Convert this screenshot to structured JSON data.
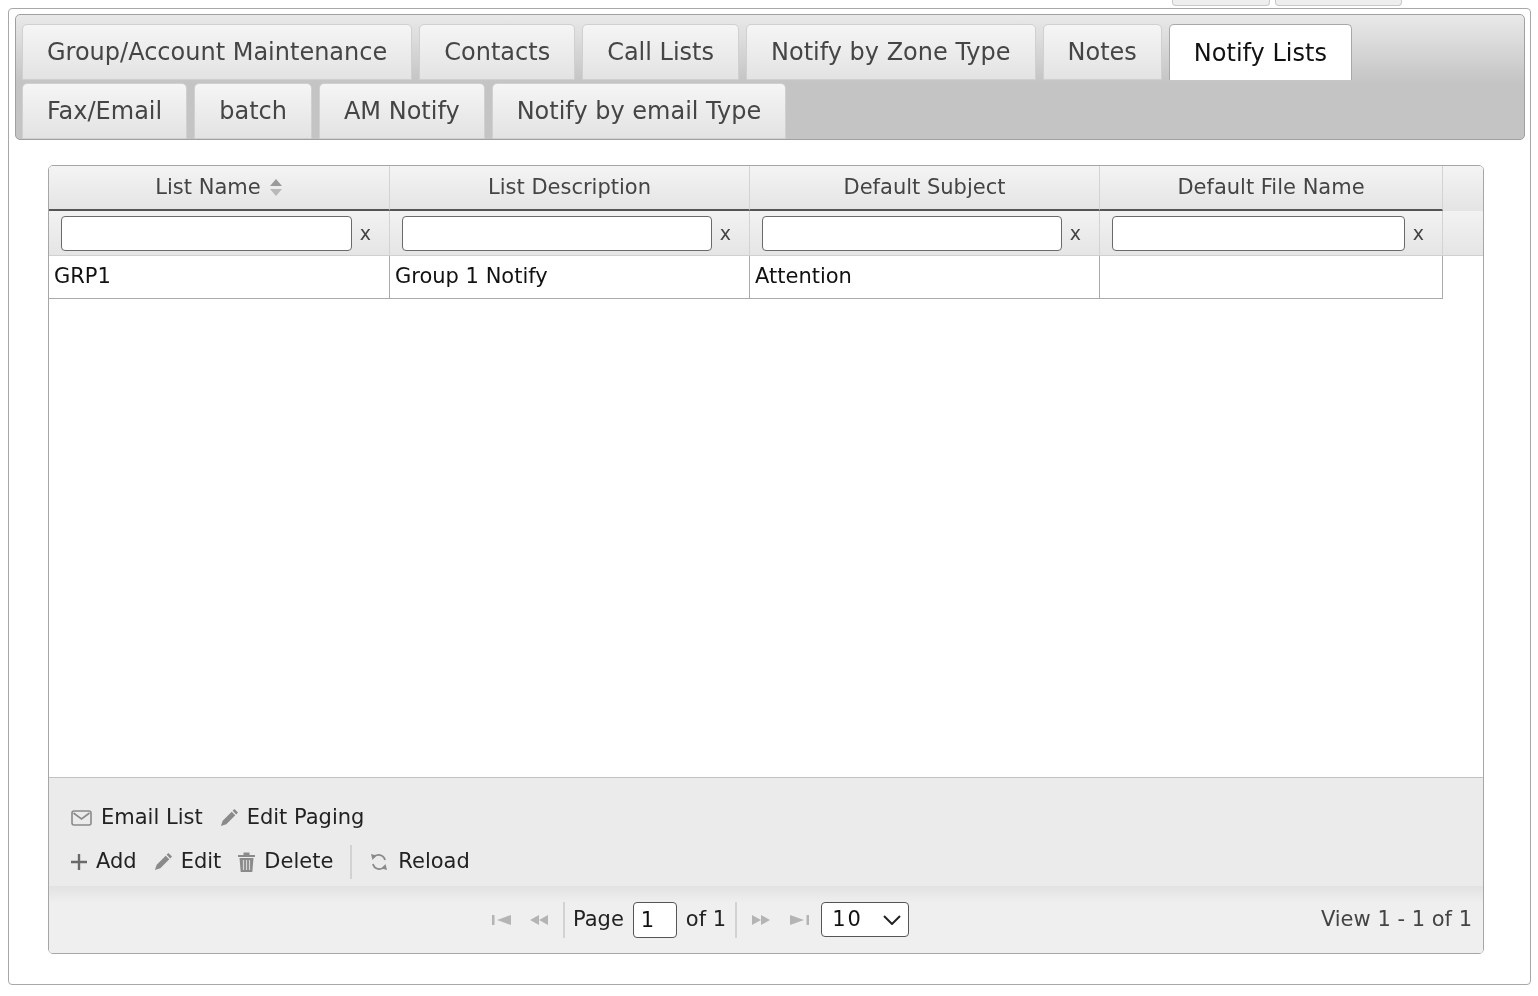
{
  "tab_rows": [
    {
      "tabs": [
        {
          "label": "Group/Account Maintenance",
          "selected": false
        },
        {
          "label": "Contacts",
          "selected": false
        },
        {
          "label": "Call Lists",
          "selected": false
        },
        {
          "label": "Notify by Zone Type",
          "selected": false
        },
        {
          "label": "Notes",
          "selected": false
        },
        {
          "label": "Notify Lists",
          "selected": true
        }
      ]
    },
    {
      "tabs": [
        {
          "label": "Fax/Email",
          "selected": false
        },
        {
          "label": "batch",
          "selected": false
        },
        {
          "label": "AM Notify",
          "selected": false
        },
        {
          "label": "Notify by email Type",
          "selected": false
        }
      ]
    }
  ],
  "grid": {
    "columns": [
      {
        "label": "List Name",
        "sorted": true
      },
      {
        "label": "List Description",
        "sorted": false
      },
      {
        "label": "Default Subject",
        "sorted": false
      },
      {
        "label": "Default File Name",
        "sorted": false
      }
    ],
    "filters": [
      {
        "clear": "x"
      },
      {
        "clear": "x"
      },
      {
        "clear": "x"
      },
      {
        "clear": "x"
      }
    ],
    "rows": [
      {
        "cells": [
          "GRP1",
          "Group 1 Notify",
          "Attention"
        ]
      }
    ],
    "toolbar": [
      {
        "items": [
          {
            "kind": "email",
            "label": "Email List"
          },
          {
            "kind": "edit",
            "label": "Edit Paging"
          }
        ]
      },
      {
        "items": [
          {
            "kind": "add",
            "label": "Add"
          },
          {
            "kind": "edit",
            "label": "Edit"
          },
          {
            "kind": "delete",
            "label": "Delete"
          },
          {
            "kind": "separator"
          },
          {
            "kind": "reload",
            "label": "Reload"
          }
        ]
      }
    ],
    "pager": {
      "nav_back": [
        {
          "kind": "first",
          "disabled": true
        },
        {
          "kind": "prev",
          "disabled": true
        }
      ],
      "page_label": "Page",
      "page": "1",
      "of_label": "of 1",
      "nav_forward": [
        {
          "kind": "next",
          "disabled": true
        },
        {
          "kind": "last",
          "disabled": true
        }
      ],
      "page_size": "10",
      "summary": "View 1 - 1 of 1"
    }
  }
}
